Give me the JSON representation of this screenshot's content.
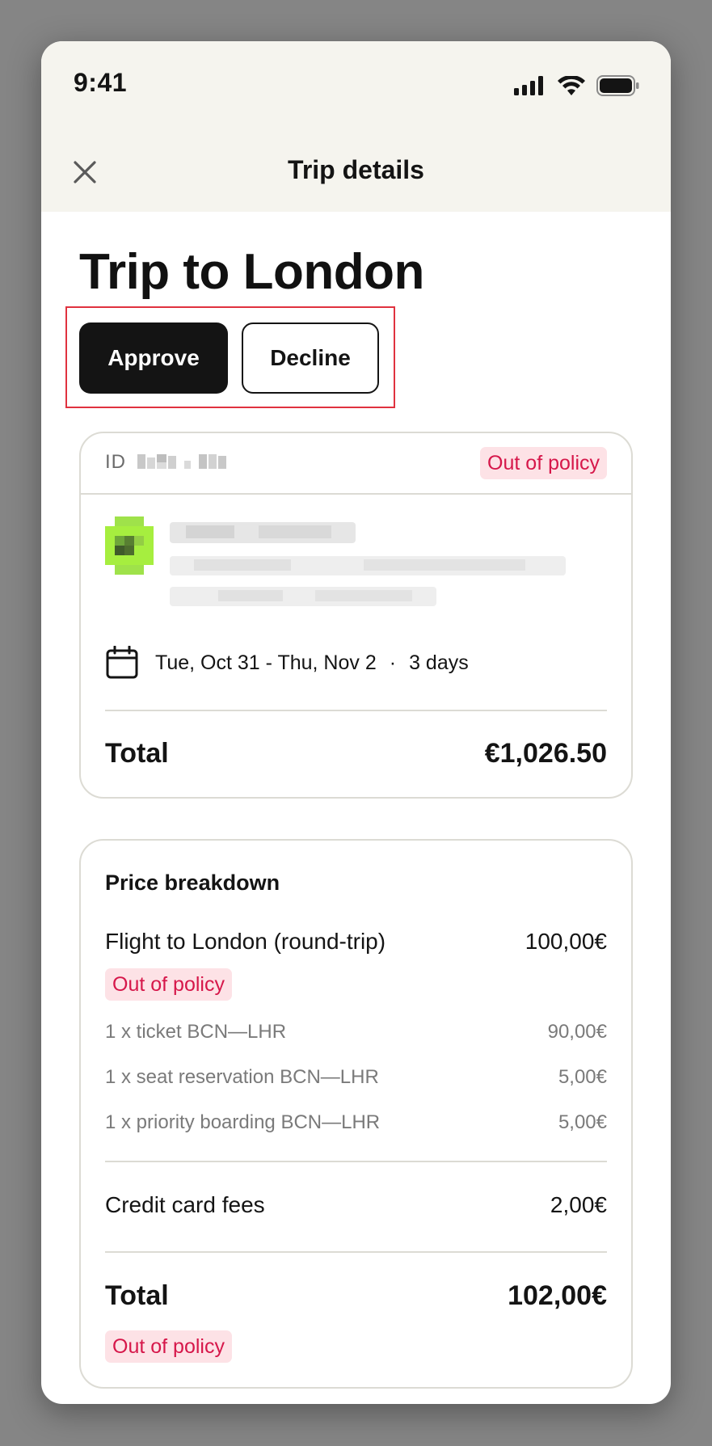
{
  "status_bar": {
    "time": "9:41",
    "icons": [
      "signal-icon",
      "wifi-icon",
      "battery-icon"
    ]
  },
  "nav": {
    "close_icon": "close-icon",
    "title": "Trip details"
  },
  "trip": {
    "title": "Trip to London",
    "actions": {
      "approve_label": "Approve",
      "decline_label": "Decline"
    }
  },
  "summary_card": {
    "id_label": "ID",
    "policy_badge": "Out of policy",
    "dates": "Tue, Oct 31 - Thu, Nov 2",
    "separator": "·",
    "duration": "3 days",
    "total_label": "Total",
    "total_value": "€1,026.50"
  },
  "price_breakdown": {
    "title": "Price breakdown",
    "flight": {
      "label": "Flight to London (round-trip)",
      "value": "100,00€",
      "badge": "Out of policy",
      "items": [
        {
          "label": "1 x ticket BCN—LHR",
          "value": "90,00€"
        },
        {
          "label": "1 x seat reservation BCN—LHR",
          "value": "5,00€"
        },
        {
          "label": "1 x priority boarding BCN—LHR",
          "value": "5,00€"
        }
      ]
    },
    "fees": {
      "label": "Credit card fees",
      "value": "2,00€"
    },
    "total": {
      "label": "Total",
      "value": "102,00€",
      "badge": "Out of policy"
    }
  },
  "colors": {
    "accent_dark": "#141414",
    "policy_text": "#d6174a",
    "policy_bg": "#fde2e6",
    "highlight": "#e0323f",
    "header_bg": "#f5f4ee"
  }
}
